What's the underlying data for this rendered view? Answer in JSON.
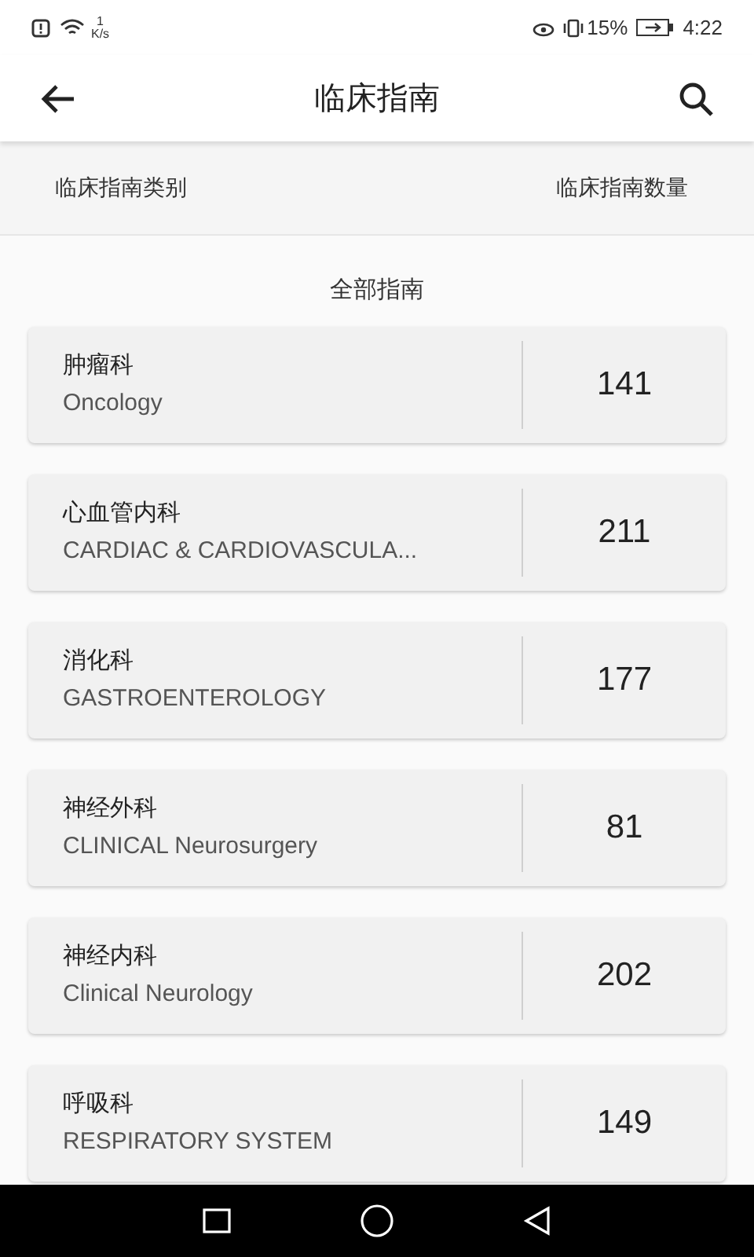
{
  "status_bar": {
    "speed_value": "1",
    "speed_unit": "K/s",
    "battery": "15%",
    "time": "4:22"
  },
  "header": {
    "title": "临床指南"
  },
  "columns": [
    "临床指南类别",
    "临床指南数量"
  ],
  "section_title": "全部指南",
  "categories": [
    {
      "name": "肿瘤科",
      "english": "Oncology",
      "count": "141"
    },
    {
      "name": "心血管内科",
      "english": "CARDIAC & CARDIOVASCULA...",
      "count": "211"
    },
    {
      "name": "消化科",
      "english": "GASTROENTEROLOGY",
      "count": "177"
    },
    {
      "name": "神经外科",
      "english": "CLINICAL Neurosurgery",
      "count": "81"
    },
    {
      "name": "神经内科",
      "english": "Clinical Neurology",
      "count": "202"
    },
    {
      "name": "呼吸科",
      "english": "RESPIRATORY SYSTEM",
      "count": "149"
    }
  ]
}
